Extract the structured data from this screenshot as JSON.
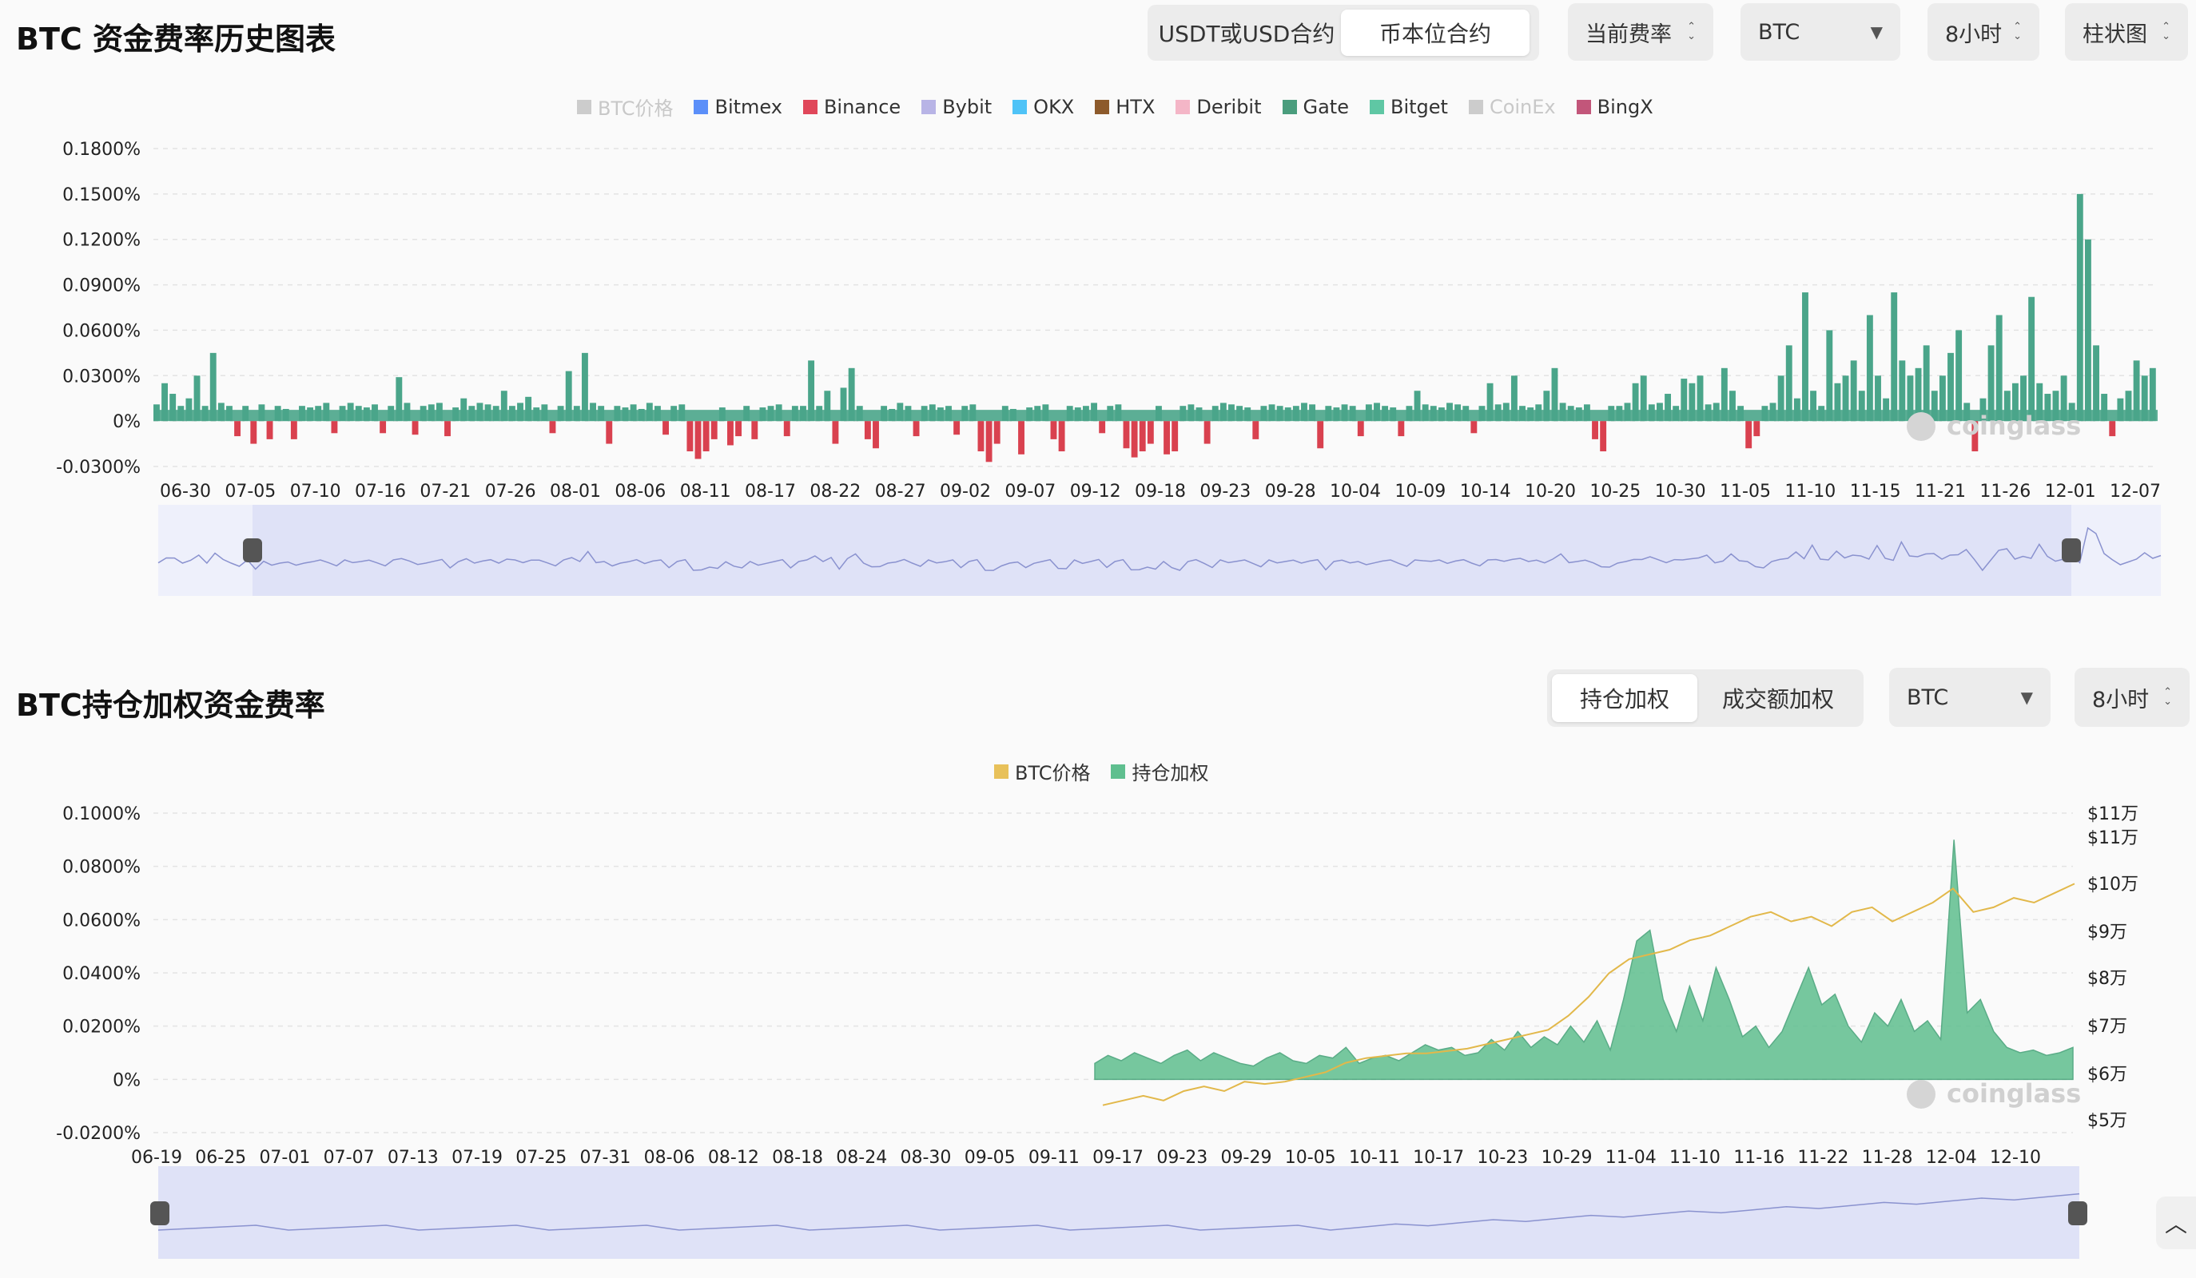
{
  "section1": {
    "title": "BTC 资金费率历史图表",
    "contract_tabs": [
      {
        "label": "USDT或USD合约",
        "active": false
      },
      {
        "label": "币本位合约",
        "active": true
      }
    ],
    "rate_select": "当前费率",
    "coin_select": "BTC",
    "interval_select": "8小时",
    "chart_type_select": "柱状图",
    "legend": [
      {
        "label": "BTC价格",
        "color": "#cccccc",
        "off": true
      },
      {
        "label": "Bitmex",
        "color": "#5b8ff9",
        "off": false
      },
      {
        "label": "Binance",
        "color": "#e0475a",
        "off": false
      },
      {
        "label": "Bybit",
        "color": "#b8b4e6",
        "off": false
      },
      {
        "label": "OKX",
        "color": "#4fc3f7",
        "off": false
      },
      {
        "label": "HTX",
        "color": "#8d5a2b",
        "off": false
      },
      {
        "label": "Deribit",
        "color": "#f4b6c7",
        "off": false
      },
      {
        "label": "Gate",
        "color": "#4a9d7d",
        "off": false
      },
      {
        "label": "Bitget",
        "color": "#5fc7a4",
        "off": false
      },
      {
        "label": "CoinEx",
        "color": "#cccccc",
        "off": true
      },
      {
        "label": "BingX",
        "color": "#c2567a",
        "off": false
      }
    ]
  },
  "section2": {
    "title": "BTC持仓加权资金费率",
    "weight_tabs": [
      {
        "label": "持仓加权",
        "active": true
      },
      {
        "label": "成交额加权",
        "active": false
      }
    ],
    "coin_select": "BTC",
    "interval_select": "8小时",
    "legend": [
      {
        "label": "BTC价格",
        "color": "#e8c15a",
        "off": false
      },
      {
        "label": "持仓加权",
        "color": "#5fbf8f",
        "off": false
      }
    ]
  },
  "watermark": "coinglass",
  "scroll_top_icon": "chevron-up-icon",
  "chart_data": [
    {
      "type": "bar",
      "title": "BTC 资金费率历史图表",
      "y_ticks": [
        "0.1800%",
        "0.1500%",
        "0.1200%",
        "0.0900%",
        "0.0600%",
        "0.0300%",
        "0%",
        "-0.0300%"
      ],
      "ylim": [
        -0.03,
        0.18
      ],
      "x_ticks": [
        "06-30",
        "07-05",
        "07-10",
        "07-16",
        "07-21",
        "07-26",
        "08-01",
        "08-06",
        "08-11",
        "08-17",
        "08-22",
        "08-27",
        "09-02",
        "09-07",
        "09-12",
        "09-18",
        "09-23",
        "09-28",
        "10-04",
        "10-09",
        "10-14",
        "10-20",
        "10-25",
        "10-30",
        "11-05",
        "11-10",
        "11-15",
        "11-21",
        "11-26",
        "12-01",
        "12-07"
      ],
      "series_note": "bars per 8h interval, positive green, negative red",
      "values": [
        0.011,
        0.025,
        0.018,
        0.01,
        0.015,
        0.03,
        0.01,
        0.045,
        0.012,
        0.01,
        -0.01,
        0.01,
        -0.015,
        0.011,
        -0.012,
        0.01,
        0.008,
        -0.012,
        0.01,
        0.009,
        0.01,
        0.012,
        -0.008,
        0.01,
        0.012,
        0.01,
        0.009,
        0.011,
        -0.008,
        0.01,
        0.029,
        0.012,
        -0.009,
        0.01,
        0.011,
        0.012,
        -0.01,
        0.009,
        0.015,
        0.01,
        0.012,
        0.011,
        0.01,
        0.02,
        0.01,
        0.012,
        0.016,
        0.009,
        0.011,
        -0.008,
        0.01,
        0.033,
        0.01,
        0.045,
        0.012,
        0.01,
        -0.015,
        0.01,
        0.009,
        0.011,
        0.008,
        0.012,
        0.01,
        -0.009,
        0.01,
        0.011,
        -0.02,
        -0.025,
        -0.02,
        -0.012,
        0.009,
        -0.016,
        -0.01,
        0.01,
        -0.012,
        0.009,
        0.01,
        0.011,
        -0.01,
        0.01,
        0.01,
        0.04,
        0.01,
        0.02,
        -0.015,
        0.022,
        0.035,
        0.01,
        -0.012,
        -0.018,
        0.01,
        0.008,
        0.012,
        0.01,
        -0.01,
        0.01,
        0.011,
        0.009,
        0.01,
        -0.009,
        0.01,
        0.011,
        -0.02,
        -0.027,
        -0.015,
        0.01,
        0.008,
        -0.022,
        0.009,
        0.01,
        0.011,
        -0.012,
        -0.02,
        0.01,
        0.009,
        0.01,
        0.012,
        -0.008,
        0.01,
        0.011,
        -0.018,
        -0.024,
        -0.02,
        -0.015,
        0.01,
        -0.022,
        -0.02,
        0.01,
        0.011,
        0.009,
        -0.015,
        0.01,
        0.012,
        0.011,
        0.01,
        0.009,
        -0.012,
        0.01,
        0.011,
        0.01,
        0.009,
        0.01,
        0.012,
        0.011,
        -0.018,
        0.01,
        0.009,
        0.011,
        0.01,
        -0.01,
        0.011,
        0.012,
        0.01,
        0.009,
        -0.01,
        0.01,
        0.02,
        0.011,
        0.01,
        0.009,
        0.012,
        0.011,
        0.01,
        -0.008,
        0.01,
        0.025,
        0.011,
        0.012,
        0.03,
        0.01,
        0.009,
        0.011,
        0.02,
        0.035,
        0.012,
        0.01,
        0.009,
        0.011,
        -0.012,
        -0.02,
        0.01,
        0.01,
        0.012,
        0.025,
        0.03,
        0.011,
        0.012,
        0.018,
        0.01,
        0.028,
        0.025,
        0.03,
        0.011,
        0.012,
        0.035,
        0.02,
        0.01,
        -0.018,
        -0.01,
        0.01,
        0.012,
        0.03,
        0.05,
        0.015,
        0.085,
        0.02,
        0.01,
        0.06,
        0.025,
        0.03,
        0.04,
        0.02,
        0.07,
        0.03,
        0.015,
        0.085,
        0.04,
        0.03,
        0.035,
        0.05,
        0.02,
        0.03,
        0.045,
        0.06,
        0.012,
        -0.02,
        0.015,
        0.05,
        0.07,
        0.02,
        0.025,
        0.03,
        0.082,
        0.025,
        0.018,
        0.02,
        0.03,
        0.012,
        0.15,
        0.12,
        0.05,
        0.018,
        -0.01,
        0.015,
        0.02,
        0.04,
        0.03,
        0.035
      ]
    },
    {
      "type": "area",
      "title": "BTC持仓加权资金费率",
      "y_ticks": [
        "0.1000%",
        "0.0800%",
        "0.0600%",
        "0.0400%",
        "0.0200%",
        "0%",
        "-0.0200%"
      ],
      "ylim": [
        -0.02,
        0.1
      ],
      "y2_ticks": [
        "$11万",
        "$11万",
        "$10万",
        "$9万",
        "$8万",
        "$7万",
        "$6万",
        "$5万"
      ],
      "x_ticks": [
        "06-19",
        "06-25",
        "07-01",
        "07-07",
        "07-13",
        "07-19",
        "07-25",
        "07-31",
        "08-06",
        "08-12",
        "08-18",
        "08-24",
        "08-30",
        "09-05",
        "09-11",
        "09-17",
        "09-23",
        "09-29",
        "10-05",
        "10-11",
        "10-17",
        "10-23",
        "10-29",
        "11-04",
        "11-10",
        "11-16",
        "11-22",
        "11-28",
        "12-04",
        "12-10"
      ],
      "series": [
        {
          "name": "持仓加权",
          "values": [
            0.006,
            0.009,
            0.007,
            0.01,
            0.008,
            0.006,
            0.009,
            0.011,
            0.007,
            0.01,
            0.008,
            0.006,
            0.005,
            0.008,
            0.01,
            0.007,
            0.006,
            0.009,
            0.008,
            0.012,
            0.006,
            0.008,
            0.009,
            0.007,
            0.01,
            0.013,
            0.011,
            0.012,
            0.009,
            0.01,
            0.015,
            0.011,
            0.018,
            0.012,
            0.016,
            0.013,
            0.02,
            0.014,
            0.022,
            0.011,
            0.03,
            0.052,
            0.056,
            0.03,
            0.018,
            0.035,
            0.022,
            0.042,
            0.03,
            0.016,
            0.02,
            0.012,
            0.018,
            0.03,
            0.042,
            0.028,
            0.032,
            0.02,
            0.014,
            0.025,
            0.02,
            0.03,
            0.018,
            0.022,
            0.015,
            0.09,
            0.025,
            0.03,
            0.018,
            0.012,
            0.01,
            0.011,
            0.009,
            0.01,
            0.012
          ]
        },
        {
          "name": "BTC价格",
          "values": [
            57000,
            58000,
            59000,
            58000,
            60000,
            61000,
            60000,
            62000,
            61500,
            62000,
            63000,
            64000,
            66000,
            67000,
            67500,
            68000,
            68000,
            68500,
            69000,
            70000,
            71000,
            72000,
            73000,
            76000,
            80000,
            85000,
            88000,
            89000,
            90000,
            92000,
            93000,
            95000,
            97000,
            98000,
            96000,
            97000,
            95000,
            98000,
            99000,
            96000,
            98000,
            100000,
            103000,
            98000,
            99000,
            101000,
            100000,
            102000,
            104000
          ]
        }
      ]
    }
  ]
}
